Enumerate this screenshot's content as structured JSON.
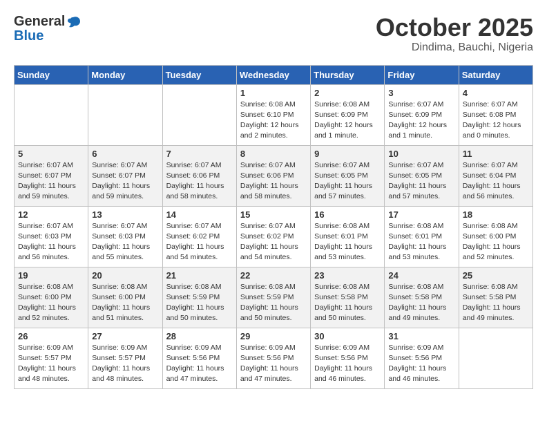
{
  "header": {
    "logo_general": "General",
    "logo_blue": "Blue",
    "month_title": "October 2025",
    "location": "Dindima, Bauchi, Nigeria"
  },
  "days_of_week": [
    "Sunday",
    "Monday",
    "Tuesday",
    "Wednesday",
    "Thursday",
    "Friday",
    "Saturday"
  ],
  "weeks": [
    [
      {
        "day": "",
        "info": ""
      },
      {
        "day": "",
        "info": ""
      },
      {
        "day": "",
        "info": ""
      },
      {
        "day": "1",
        "info": "Sunrise: 6:08 AM\nSunset: 6:10 PM\nDaylight: 12 hours\nand 2 minutes."
      },
      {
        "day": "2",
        "info": "Sunrise: 6:08 AM\nSunset: 6:09 PM\nDaylight: 12 hours\nand 1 minute."
      },
      {
        "day": "3",
        "info": "Sunrise: 6:07 AM\nSunset: 6:09 PM\nDaylight: 12 hours\nand 1 minute."
      },
      {
        "day": "4",
        "info": "Sunrise: 6:07 AM\nSunset: 6:08 PM\nDaylight: 12 hours\nand 0 minutes."
      }
    ],
    [
      {
        "day": "5",
        "info": "Sunrise: 6:07 AM\nSunset: 6:07 PM\nDaylight: 11 hours\nand 59 minutes."
      },
      {
        "day": "6",
        "info": "Sunrise: 6:07 AM\nSunset: 6:07 PM\nDaylight: 11 hours\nand 59 minutes."
      },
      {
        "day": "7",
        "info": "Sunrise: 6:07 AM\nSunset: 6:06 PM\nDaylight: 11 hours\nand 58 minutes."
      },
      {
        "day": "8",
        "info": "Sunrise: 6:07 AM\nSunset: 6:06 PM\nDaylight: 11 hours\nand 58 minutes."
      },
      {
        "day": "9",
        "info": "Sunrise: 6:07 AM\nSunset: 6:05 PM\nDaylight: 11 hours\nand 57 minutes."
      },
      {
        "day": "10",
        "info": "Sunrise: 6:07 AM\nSunset: 6:05 PM\nDaylight: 11 hours\nand 57 minutes."
      },
      {
        "day": "11",
        "info": "Sunrise: 6:07 AM\nSunset: 6:04 PM\nDaylight: 11 hours\nand 56 minutes."
      }
    ],
    [
      {
        "day": "12",
        "info": "Sunrise: 6:07 AM\nSunset: 6:03 PM\nDaylight: 11 hours\nand 56 minutes."
      },
      {
        "day": "13",
        "info": "Sunrise: 6:07 AM\nSunset: 6:03 PM\nDaylight: 11 hours\nand 55 minutes."
      },
      {
        "day": "14",
        "info": "Sunrise: 6:07 AM\nSunset: 6:02 PM\nDaylight: 11 hours\nand 54 minutes."
      },
      {
        "day": "15",
        "info": "Sunrise: 6:07 AM\nSunset: 6:02 PM\nDaylight: 11 hours\nand 54 minutes."
      },
      {
        "day": "16",
        "info": "Sunrise: 6:08 AM\nSunset: 6:01 PM\nDaylight: 11 hours\nand 53 minutes."
      },
      {
        "day": "17",
        "info": "Sunrise: 6:08 AM\nSunset: 6:01 PM\nDaylight: 11 hours\nand 53 minutes."
      },
      {
        "day": "18",
        "info": "Sunrise: 6:08 AM\nSunset: 6:00 PM\nDaylight: 11 hours\nand 52 minutes."
      }
    ],
    [
      {
        "day": "19",
        "info": "Sunrise: 6:08 AM\nSunset: 6:00 PM\nDaylight: 11 hours\nand 52 minutes."
      },
      {
        "day": "20",
        "info": "Sunrise: 6:08 AM\nSunset: 6:00 PM\nDaylight: 11 hours\nand 51 minutes."
      },
      {
        "day": "21",
        "info": "Sunrise: 6:08 AM\nSunset: 5:59 PM\nDaylight: 11 hours\nand 50 minutes."
      },
      {
        "day": "22",
        "info": "Sunrise: 6:08 AM\nSunset: 5:59 PM\nDaylight: 11 hours\nand 50 minutes."
      },
      {
        "day": "23",
        "info": "Sunrise: 6:08 AM\nSunset: 5:58 PM\nDaylight: 11 hours\nand 50 minutes."
      },
      {
        "day": "24",
        "info": "Sunrise: 6:08 AM\nSunset: 5:58 PM\nDaylight: 11 hours\nand 49 minutes."
      },
      {
        "day": "25",
        "info": "Sunrise: 6:08 AM\nSunset: 5:58 PM\nDaylight: 11 hours\nand 49 minutes."
      }
    ],
    [
      {
        "day": "26",
        "info": "Sunrise: 6:09 AM\nSunset: 5:57 PM\nDaylight: 11 hours\nand 48 minutes."
      },
      {
        "day": "27",
        "info": "Sunrise: 6:09 AM\nSunset: 5:57 PM\nDaylight: 11 hours\nand 48 minutes."
      },
      {
        "day": "28",
        "info": "Sunrise: 6:09 AM\nSunset: 5:56 PM\nDaylight: 11 hours\nand 47 minutes."
      },
      {
        "day": "29",
        "info": "Sunrise: 6:09 AM\nSunset: 5:56 PM\nDaylight: 11 hours\nand 47 minutes."
      },
      {
        "day": "30",
        "info": "Sunrise: 6:09 AM\nSunset: 5:56 PM\nDaylight: 11 hours\nand 46 minutes."
      },
      {
        "day": "31",
        "info": "Sunrise: 6:09 AM\nSunset: 5:56 PM\nDaylight: 11 hours\nand 46 minutes."
      },
      {
        "day": "",
        "info": ""
      }
    ]
  ]
}
